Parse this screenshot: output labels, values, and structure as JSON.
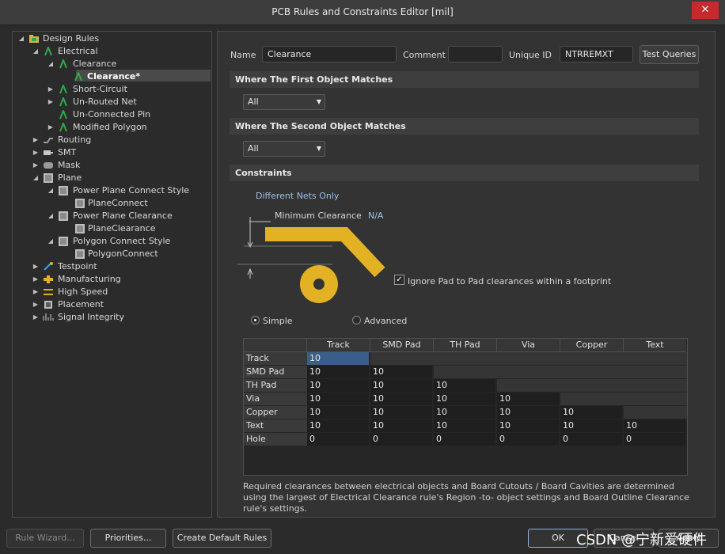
{
  "window": {
    "title": "PCB Rules and Constraints Editor [mil]",
    "close_glyph": "✕"
  },
  "tree": {
    "root": "Design Rules",
    "electrical": "Electrical",
    "clearance": "Clearance",
    "clearance_rule": "Clearance*",
    "short_circuit": "Short-Circuit",
    "unrouted_net": "Un-Routed Net",
    "unconnected_pin": "Un-Connected Pin",
    "modified_polygon": "Modified Polygon",
    "routing": "Routing",
    "smt": "SMT",
    "mask": "Mask",
    "plane": "Plane",
    "ppcs": "Power Plane Connect Style",
    "plane_connect": "PlaneConnect",
    "ppc": "Power Plane Clearance",
    "plane_clearance": "PlaneClearance",
    "pcs": "Polygon Connect Style",
    "polygon_connect": "PolygonConnect",
    "testpoint": "Testpoint",
    "manufacturing": "Manufacturing",
    "high_speed": "High Speed",
    "placement": "Placement",
    "signal_integrity": "Signal Integrity"
  },
  "header": {
    "name_label": "Name",
    "name_value": "Clearance",
    "comment_label": "Comment",
    "comment_value": "",
    "uid_label": "Unique ID",
    "uid_value": "NTRREMXT",
    "test_queries": "Test Queries"
  },
  "first_match": {
    "title": "Where The First Object Matches",
    "value": "All"
  },
  "second_match": {
    "title": "Where The Second Object Matches",
    "value": "All"
  },
  "constraints": {
    "title": "Constraints",
    "different_nets": "Different Nets Only",
    "min_clearance": "Minimum Clearance",
    "min_value": "N/A",
    "ignore_pad": "Ignore Pad to Pad clearances within a footprint",
    "simple": "Simple",
    "advanced": "Advanced",
    "columns": [
      "Track",
      "SMD Pad",
      "TH Pad",
      "Via",
      "Copper",
      "Text"
    ],
    "rows": [
      {
        "name": "Track",
        "values": [
          "10"
        ]
      },
      {
        "name": "SMD Pad",
        "values": [
          "10",
          "10"
        ]
      },
      {
        "name": "TH Pad",
        "values": [
          "10",
          "10",
          "10"
        ]
      },
      {
        "name": "Via",
        "values": [
          "10",
          "10",
          "10",
          "10"
        ]
      },
      {
        "name": "Copper",
        "values": [
          "10",
          "10",
          "10",
          "10",
          "10"
        ]
      },
      {
        "name": "Text",
        "values": [
          "10",
          "10",
          "10",
          "10",
          "10",
          "10"
        ]
      },
      {
        "name": "Hole",
        "values": [
          "0",
          "0",
          "0",
          "0",
          "0",
          "0"
        ]
      }
    ],
    "note": "Required clearances between electrical objects and Board Cutouts / Board Cavities are determined using the largest of Electrical Clearance rule's Region -to- object settings and Board Outline Clearance rule's settings."
  },
  "footer": {
    "rule_wizard": "Rule Wizard...",
    "priorities": "Priorities...",
    "create_default": "Create Default Rules",
    "ok": "OK",
    "cancel": "Cancel",
    "apply": "Apply",
    "watermark": "CSDN @宁新爱硬件"
  },
  "colors": {
    "accent_yellow": "#e2b224",
    "icon_green": "#2fa84a",
    "selection": "#4a4a4a"
  }
}
